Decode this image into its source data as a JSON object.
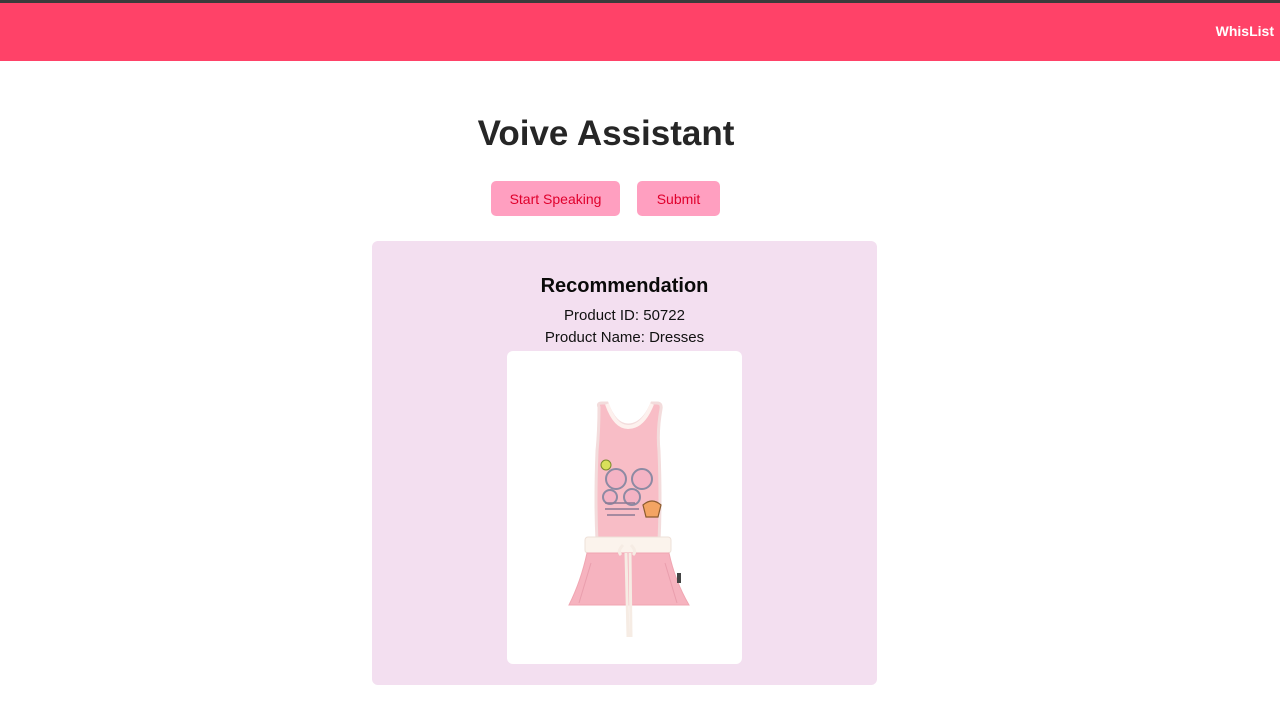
{
  "navbar": {
    "link_label": "WhisList",
    "bg_color": "#ff4268"
  },
  "page": {
    "title": "Voive Assistant"
  },
  "actions": {
    "start_label": "Start Speaking",
    "submit_label": "Submit",
    "button_bg": "#ff9fc0",
    "button_text_color": "#e0002c"
  },
  "recommendation": {
    "heading": "Recommendation",
    "product_id_label": "Product ID:",
    "product_id": "50722",
    "product_name_label": "Product Name:",
    "product_name": "Dresses",
    "card_bg": "#f3dff0",
    "image": "pink sleeveless dress with floral print"
  }
}
